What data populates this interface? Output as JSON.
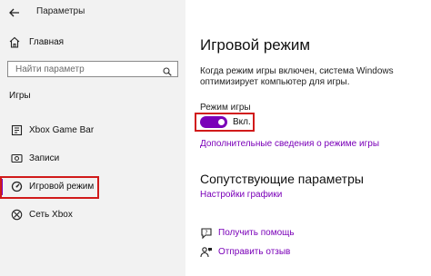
{
  "app": {
    "title": "Параметры"
  },
  "sidebar": {
    "home_label": "Главная",
    "search_placeholder": "Найти параметр",
    "section_label": "Игры",
    "items": [
      {
        "label": "Xbox Game Bar",
        "icon": "xbox-game-bar-icon",
        "active": false
      },
      {
        "label": "Записи",
        "icon": "captures-icon",
        "active": false
      },
      {
        "label": "Игровой режим",
        "icon": "game-mode-icon",
        "active": true
      },
      {
        "label": "Сеть Xbox",
        "icon": "xbox-icon",
        "active": false
      }
    ]
  },
  "main": {
    "title": "Игровой режим",
    "description": "Когда режим игры включен, система Windows оптимизирует компьютер для игры.",
    "toggle_label": "Режим игры",
    "toggle_state": "Вкл.",
    "toggle_on": true,
    "more_info_link": "Дополнительные сведения о режиме игры",
    "related_title": "Сопутствующие параметры",
    "graphics_link": "Настройки графики",
    "help_items": [
      {
        "label": "Получить помощь",
        "icon": "help-icon"
      },
      {
        "label": "Отправить отзыв",
        "icon": "feedback-icon"
      }
    ]
  },
  "colors": {
    "accent": "#7a00b8",
    "highlight": "#d11a1a",
    "sidebar_bg": "#f2f2f2"
  }
}
